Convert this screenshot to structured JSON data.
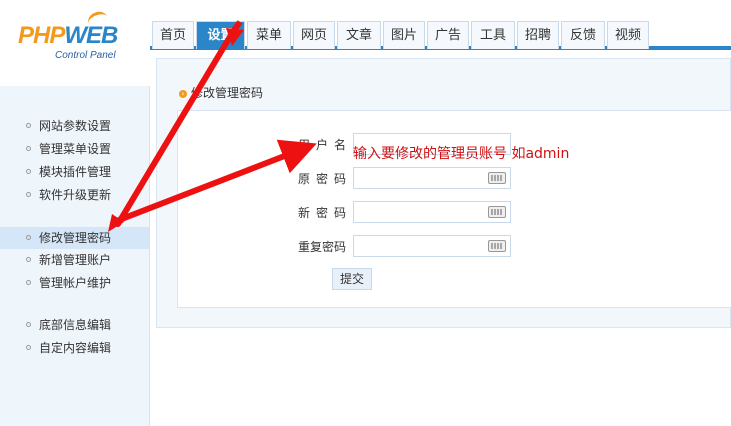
{
  "logo": {
    "php": "PHP",
    "web": "WEB",
    "subtitle": "Control Panel"
  },
  "nav": {
    "tabs": [
      "首页",
      "设置",
      "菜单",
      "网页",
      "文章",
      "图片",
      "广告",
      "工具",
      "招聘",
      "反馈",
      "视频"
    ],
    "active": "设置"
  },
  "sidebar": {
    "items": [
      "网站参数设置",
      "管理菜单设置",
      "模块插件管理",
      "软件升级更新",
      "修改管理密码",
      "新增管理账户",
      "管理帐户维护",
      "底部信息编辑",
      "自定内容编辑"
    ],
    "active": "修改管理密码"
  },
  "main": {
    "breadcrumb": "修改管理密码",
    "form": {
      "username_label": "用户名",
      "old_password_label": "原密码",
      "new_password_label": "新密码",
      "repeat_password_label": "重复密码",
      "username_value": "",
      "submit_label": "提交"
    },
    "annotation": "输入要修改的管理员账号 如admin"
  },
  "colors": {
    "accent": "#2a86c8",
    "logo_orange": "#f39a1c",
    "annotation": "#d01010"
  }
}
